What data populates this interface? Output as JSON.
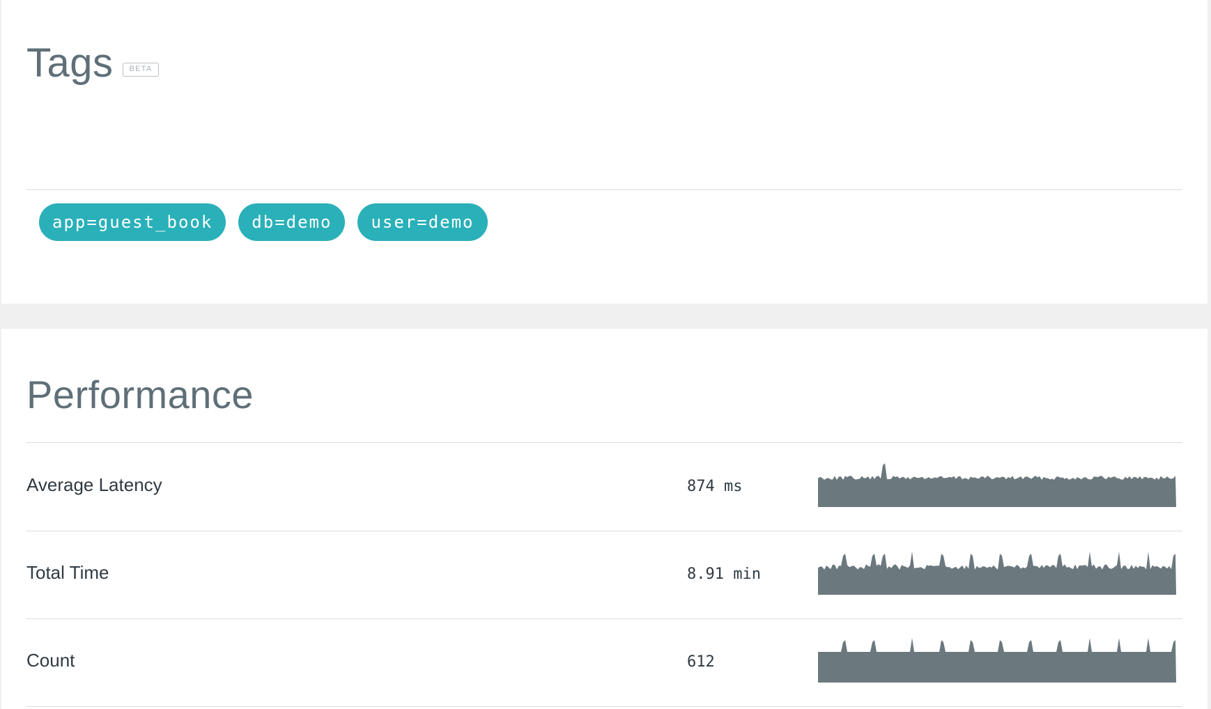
{
  "tags_section": {
    "title": "Tags",
    "badge": "BETA",
    "tags": [
      "app=guest_book",
      "db=demo",
      "user=demo"
    ]
  },
  "performance_section": {
    "title": "Performance",
    "metrics": [
      {
        "name": "Average Latency",
        "value": "874 ms"
      },
      {
        "name": "Total Time",
        "value": "8.91 min"
      },
      {
        "name": "Count",
        "value": "612"
      }
    ]
  },
  "colors": {
    "tag_background": "#2ab0b9",
    "sparkline_fill": "#6b787e",
    "title_text": "#5f6f78"
  }
}
